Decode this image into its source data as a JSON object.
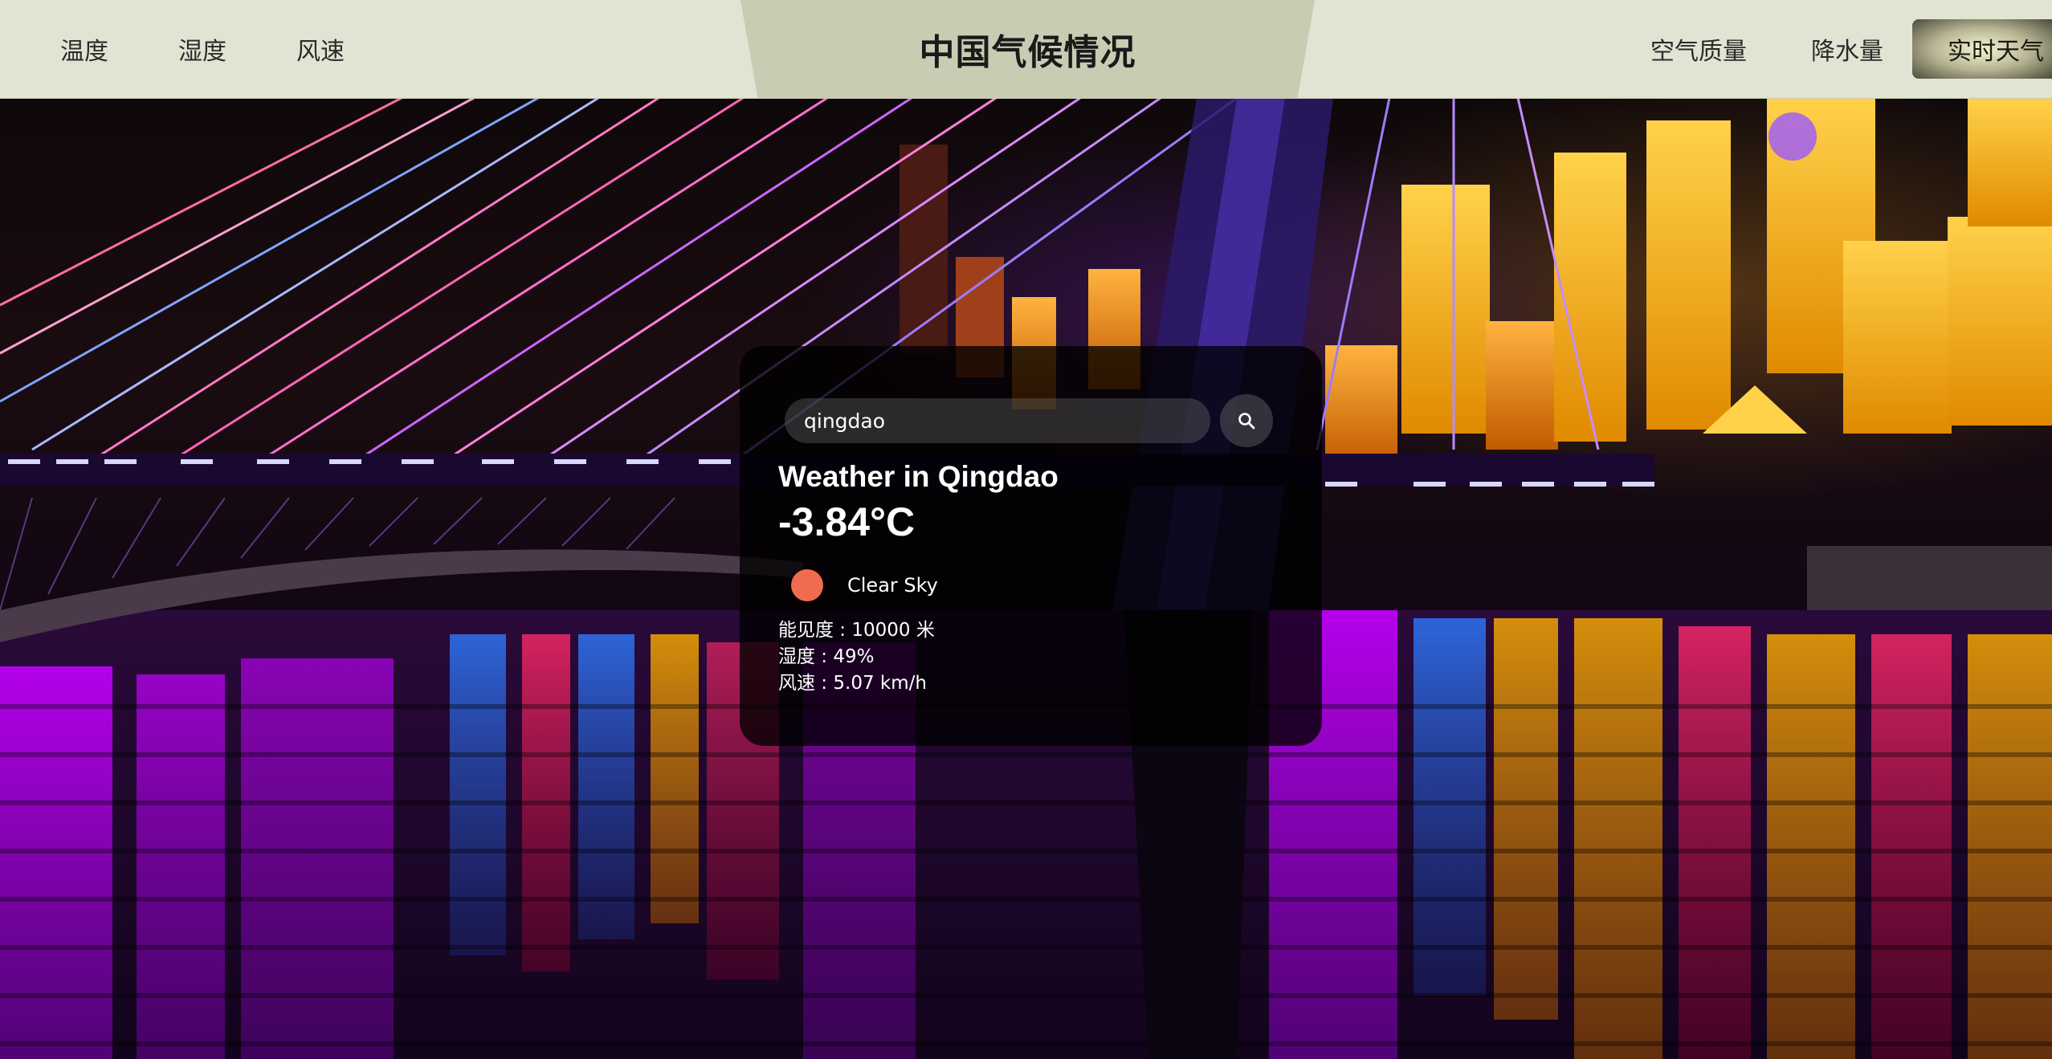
{
  "header": {
    "title": "中国气候情况",
    "left_links": [
      "温度",
      "湿度",
      "风速"
    ],
    "right_links": [
      "空气质量",
      "降水量"
    ],
    "live_button": "实时天气"
  },
  "weather": {
    "search_value": "qingdao",
    "search_icon": "search-icon",
    "city_title": "Weather in Qingdao",
    "temperature": "-3.84°C",
    "condition_icon": "clear-sky-icon",
    "condition": "Clear Sky",
    "visibility": "能见度 : 10000 米",
    "humidity": "湿度 : 49%",
    "wind": "风速 : 5.07 km/h"
  },
  "colors": {
    "header_bg": "#e2e4d3",
    "title_plate": "#c9cbb3",
    "card_bg": "rgba(0,0,0,0.78)",
    "condition_icon": "#f06b4f"
  }
}
